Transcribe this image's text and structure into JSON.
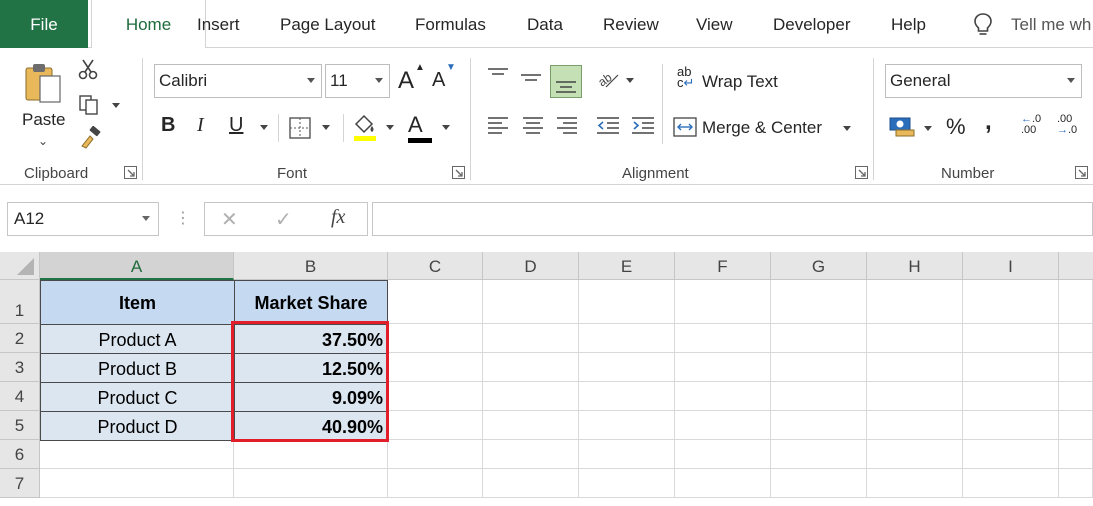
{
  "tabs": [
    {
      "id": "file",
      "label": "File"
    },
    {
      "id": "home",
      "label": "Home"
    },
    {
      "id": "insert",
      "label": "Insert"
    },
    {
      "id": "page-layout",
      "label": "Page Layout"
    },
    {
      "id": "formulas",
      "label": "Formulas"
    },
    {
      "id": "data",
      "label": "Data"
    },
    {
      "id": "review",
      "label": "Review"
    },
    {
      "id": "view",
      "label": "View"
    },
    {
      "id": "developer",
      "label": "Developer"
    },
    {
      "id": "help",
      "label": "Help"
    }
  ],
  "tell_me": "Tell me wh",
  "ribbon": {
    "clipboard": {
      "label": "Clipboard",
      "paste": "Paste"
    },
    "font": {
      "label": "Font",
      "name": "Calibri",
      "size": "11",
      "bold": "B",
      "italic": "I",
      "underline": "U",
      "grow": "A",
      "shrink": "A",
      "color_letter": "A"
    },
    "alignment": {
      "label": "Alignment",
      "wrap": "Wrap Text",
      "merge": "Merge & Center",
      "wrap_icon_top": "ab",
      "wrap_icon_bottom": "c"
    },
    "number": {
      "label": "Number",
      "format": "General",
      "percent": "%",
      "comma": ",",
      "inc_dec": ".00",
      "dec_dec": ".0"
    }
  },
  "formula_bar": {
    "name_box": "A12",
    "cancel": "✕",
    "enter": "✓",
    "fx": "fx",
    "value": ""
  },
  "colors": {
    "accent": "#217346",
    "header_fill": "#c5d9f1",
    "data_fill": "#dce6f1",
    "highlight": "#e31e2b"
  },
  "sheet": {
    "columns": [
      "A",
      "B",
      "C",
      "D",
      "E",
      "F",
      "G",
      "H",
      "I"
    ],
    "rows": [
      "1",
      "2",
      "3",
      "4",
      "5",
      "6",
      "7"
    ],
    "header": [
      "Item",
      "Market Share"
    ],
    "data": [
      [
        "Product A",
        "37.50%"
      ],
      [
        "Product B",
        "12.50%"
      ],
      [
        "Product C",
        "9.09%"
      ],
      [
        "Product D",
        "40.90%"
      ]
    ]
  }
}
